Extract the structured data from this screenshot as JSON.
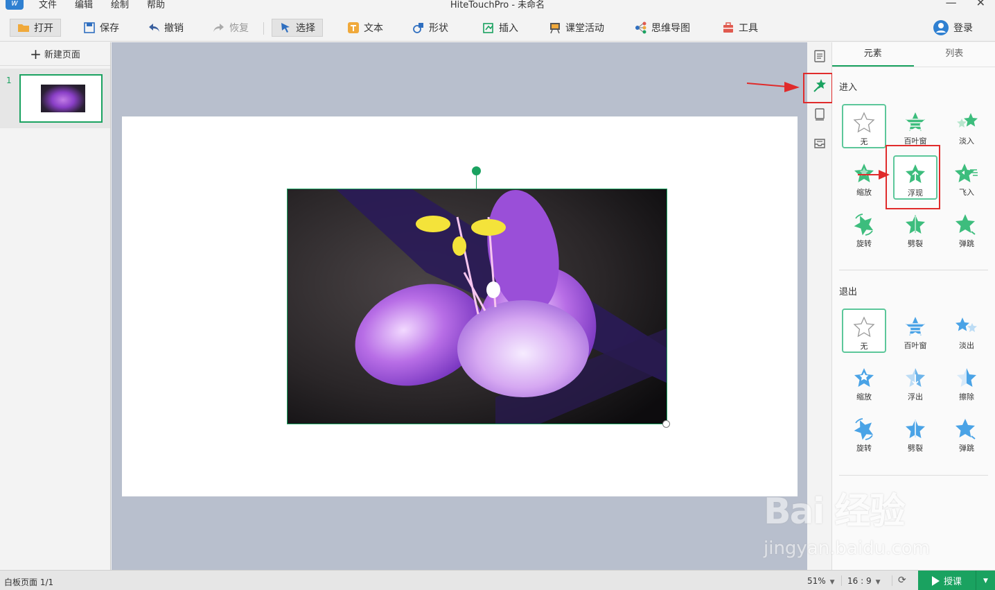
{
  "titlebar": {
    "menu": [
      "文件",
      "编辑",
      "绘制",
      "帮助"
    ],
    "title": "HiteTouchPro - 未命名",
    "minimize": "—",
    "close": "✕"
  },
  "toolbar": {
    "open": "打开",
    "save": "保存",
    "undo": "撤销",
    "redo": "恢复",
    "select": "选择",
    "text": "文本",
    "shape": "形状",
    "insert": "插入",
    "class_activity": "课堂活动",
    "mindmap": "思维导图",
    "tools": "工具",
    "login": "登录"
  },
  "pages": {
    "new_page": "新建页面",
    "items": [
      {
        "number": "1"
      }
    ]
  },
  "anim_panel": {
    "tabs": [
      "元素",
      "列表"
    ],
    "enter_title": "进入",
    "enter_items": [
      {
        "label": "无",
        "icon": "star-outline-icon",
        "selected": true
      },
      {
        "label": "百叶窗",
        "icon": "blinds-star-icon"
      },
      {
        "label": "淡入",
        "icon": "fade-in-star-icon"
      },
      {
        "label": "缩放",
        "icon": "zoom-star-icon"
      },
      {
        "label": "浮现",
        "icon": "float-in-star-icon",
        "selected": true
      },
      {
        "label": "飞入",
        "icon": "fly-in-star-icon"
      },
      {
        "label": "旋转",
        "icon": "rotate-star-icon"
      },
      {
        "label": "劈裂",
        "icon": "split-star-icon"
      },
      {
        "label": "弹跳",
        "icon": "bounce-star-icon"
      }
    ],
    "exit_title": "退出",
    "exit_items": [
      {
        "label": "无",
        "icon": "star-outline-icon",
        "selected": true
      },
      {
        "label": "百叶窗",
        "icon": "blinds-star-icon"
      },
      {
        "label": "淡出",
        "icon": "fade-out-star-icon"
      },
      {
        "label": "缩放",
        "icon": "zoom-star-icon"
      },
      {
        "label": "浮出",
        "icon": "float-out-star-icon"
      },
      {
        "label": "擦除",
        "icon": "wipe-star-icon"
      },
      {
        "label": "旋转",
        "icon": "rotate-star-icon"
      },
      {
        "label": "劈裂",
        "icon": "split-star-icon"
      },
      {
        "label": "弹跳",
        "icon": "bounce-star-icon"
      }
    ]
  },
  "statusbar": {
    "page_info": "白板页面 1/1",
    "zoom": "51%",
    "ratio": "16 : 9",
    "teach": "授课"
  },
  "watermark": {
    "brand": "Bai 经验",
    "url": "jingyan.baidu.com"
  },
  "colors": {
    "accent": "#1aa260",
    "enter_icon": "#3dbd7d",
    "exit_icon": "#4aa3e6",
    "annotation_red": "#e02b2b"
  }
}
